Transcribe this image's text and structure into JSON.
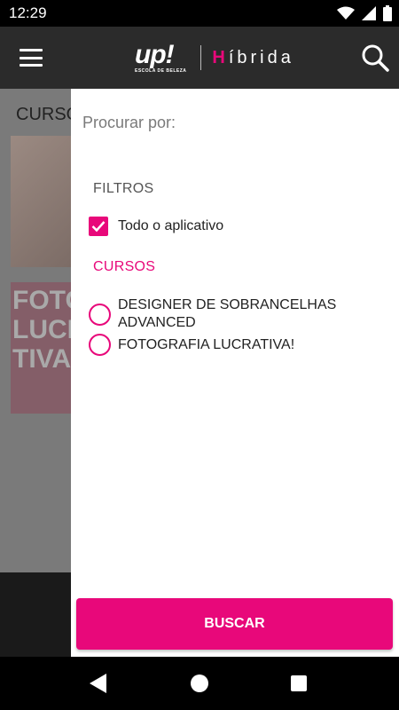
{
  "status_bar": {
    "time": "12:29"
  },
  "header": {
    "logo_main": "up!",
    "logo_sub": "ESCOLA DE BELEZA",
    "logo_h": "H",
    "logo_rest": "íbrida",
    "icons": [
      "menu-icon",
      "search-icon"
    ]
  },
  "background": {
    "section_title": "CURSOS",
    "thumb2_text": "FOTO LUCR TIVA"
  },
  "filter_panel": {
    "search_prompt": "Procurar por:",
    "filters_title": "FILTROS",
    "checkbox_label": "Todo o aplicativo",
    "checkbox_checked": true,
    "courses_title": "CURSOS",
    "courses": [
      {
        "label_line1": "DESIGNER DE SOBRANCELHAS",
        "label_line2": "ADVANCED"
      },
      {
        "label_line1": "FOTOGRAFIA LUCRATIVA!",
        "label_line2": ""
      }
    ],
    "buscar_label": "BUSCAR"
  },
  "colors": {
    "accent": "#e8087a",
    "app_bar": "#2b2b2b"
  }
}
